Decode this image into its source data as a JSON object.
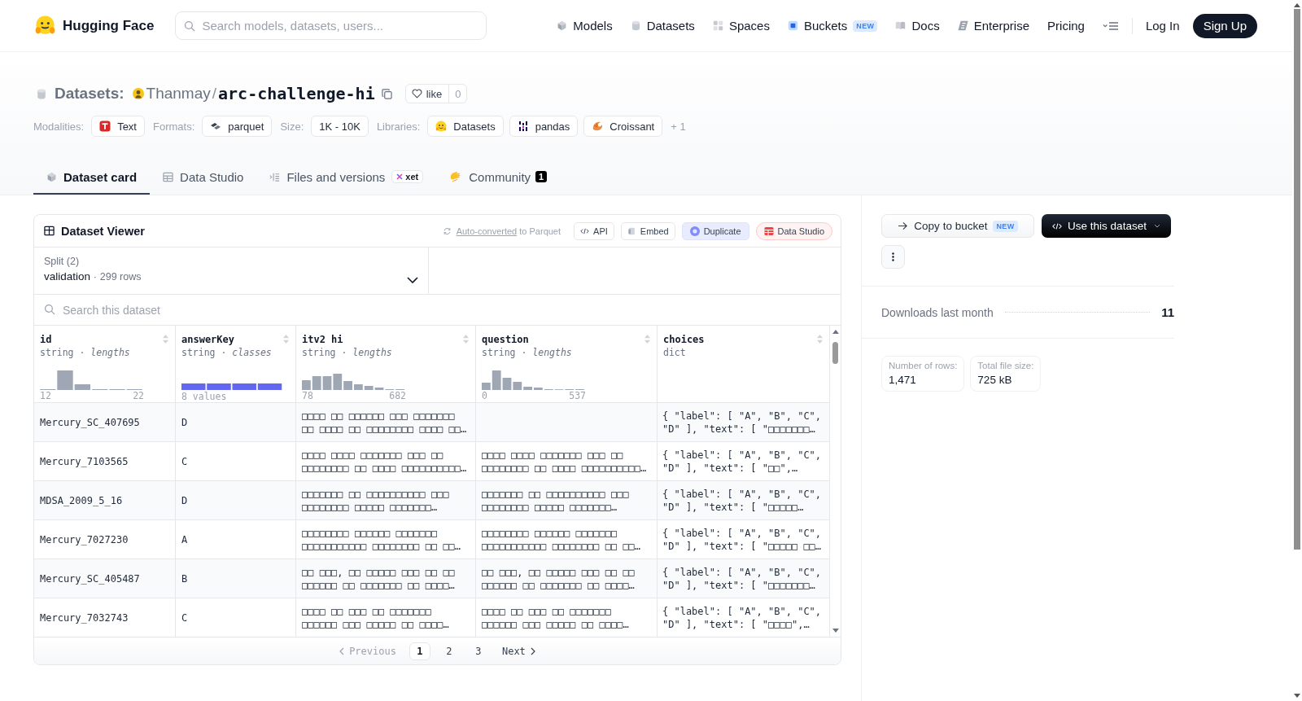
{
  "header": {
    "site_name": "Hugging Face",
    "search": {
      "placeholder": "Search models, datasets, users..."
    },
    "nav": [
      {
        "label": "Models",
        "kind": "models"
      },
      {
        "label": "Datasets",
        "kind": "datasets"
      },
      {
        "label": "Spaces",
        "kind": "spaces"
      },
      {
        "label": "Buckets",
        "kind": "buckets",
        "badge": "NEW"
      },
      {
        "label": "Docs",
        "kind": "docs"
      },
      {
        "label": "Enterprise",
        "kind": "enterprise"
      },
      {
        "label": "Pricing",
        "kind": "pricing"
      }
    ],
    "auth": [
      {
        "label": "Log In",
        "kind": "link"
      },
      {
        "label": "Sign Up",
        "kind": "primary"
      }
    ]
  },
  "dataset": {
    "section": "Datasets:",
    "owner": "Thanmay",
    "separator": "/",
    "name": "arc-challenge-hi",
    "like": {
      "label": "like",
      "count": "0"
    },
    "tag_groups": [
      {
        "label": "Modalities:",
        "chips": [
          {
            "text": "Text",
            "kind": "text"
          }
        ]
      },
      {
        "label": "Formats:",
        "chips": [
          {
            "text": "parquet",
            "kind": "parquet"
          }
        ]
      },
      {
        "label": "Size:",
        "chips": [
          {
            "text": "1K - 10K",
            "kind": "plain"
          }
        ]
      },
      {
        "label": "Libraries:",
        "chips": [
          {
            "text": "Datasets",
            "kind": "datasets"
          },
          {
            "text": "pandas",
            "kind": "pandas"
          },
          {
            "text": "Croissant",
            "kind": "croissant"
          }
        ]
      }
    ],
    "more_tags": "+ 1"
  },
  "tabs": [
    {
      "label": "Dataset card",
      "kind": "card",
      "selected": true
    },
    {
      "label": "Data Studio",
      "kind": "table",
      "selected": false
    },
    {
      "label": "Files and versions",
      "kind": "files",
      "badge": "xet",
      "selected": false
    },
    {
      "label": "Community",
      "kind": "community",
      "count": "1",
      "selected": false
    }
  ],
  "viewer": {
    "title": "Dataset Viewer",
    "conversion": {
      "link": "Auto-converted",
      "text": "to Parquet"
    },
    "actions": [
      {
        "label": "API",
        "kind": "api"
      },
      {
        "label": "Embed",
        "kind": "embed"
      },
      {
        "label": "Duplicate",
        "kind": "duplicate"
      },
      {
        "label": "Data Studio",
        "kind": "studio"
      }
    ],
    "split": {
      "label": "Split (2)",
      "value": "validation",
      "separator": "·",
      "rows": "299 rows"
    },
    "search": {
      "placeholder": "Search this dataset"
    },
    "columns": [
      {
        "name": "id",
        "type": "string · *lengths*",
        "kind": "histogram",
        "min": "12",
        "max": "22"
      },
      {
        "name": "answerKey",
        "type": "string · *classes*",
        "kind": "classes",
        "summary": "8 values"
      },
      {
        "name": "itv2 hi",
        "type": "string · *lengths*",
        "kind": "histogram",
        "min": "78",
        "max": "682"
      },
      {
        "name": "question",
        "type": "string · *lengths*",
        "kind": "histogram",
        "min": "0",
        "max": "537"
      },
      {
        "name": "choices",
        "type": "dict",
        "kind": "none"
      }
    ],
    "rows": [
      {
        "id": "Mercury_SC_407695",
        "answer_key": "D",
        "itv2_hi": "□□□□ □□ □□□□□□ □□□ □□□□□□□ □□ □□□□ □□ □□□□□□□□ □□□□ □□…",
        "choices": "{ \"label\": [ \"A\", \"B\", \"C\", \"D\" ], \"text\": [ \"□□□□□□□…"
      },
      {
        "id": "Mercury_7103565",
        "answer_key": "C",
        "itv2_hi": "□□□□ □□□□ □□□□□□□ □□□ □□ □□□□□□□□ □□ □□□□ □□□□□□□□□□…",
        "question": "□□□□ □□□□ □□□□□□□ □□□ □□ □□□□□□□□ □□ □□□□ □□□□□□□□□□…",
        "choices": "{ \"label\": [ \"A\", \"B\", \"C\", \"D\" ], \"text\": [ \"□□\",…"
      },
      {
        "id": "MDSA_2009_5_16",
        "answer_key": "D",
        "itv2_hi": "□□□□□□□ □□ □□□□□□□□□□ □□□ □□□□□□□□ □□□□□ □□□□□□□…",
        "question": "□□□□□□□ □□ □□□□□□□□□□ □□□ □□□□□□□□ □□□□□ □□□□□□□…",
        "choices": "{ \"label\": [ \"A\", \"B\", \"C\", \"D\" ], \"text\": [ \"□□□□□…"
      },
      {
        "id": "Mercury_7027230",
        "answer_key": "A",
        "itv2_hi": "□□□□□□□□ □□□□□□ □□□□□□□ □□□□□□□□□□□ □□□□□□□□ □□ □□…",
        "question": "□□□□□□□□ □□□□□□ □□□□□□□ □□□□□□□□□□□ □□□□□□□□ □□ □□…",
        "choices": "{ \"label\": [ \"A\", \"B\", \"C\", \"D\" ], \"text\": [ \"□□□□□ □□…"
      },
      {
        "id": "Mercury_SC_405487",
        "answer_key": "B",
        "itv2_hi": "□□ □□□, □□ □□□□□ □□□ □□ □□ □□□□□□ □□ □□□□□□□ □□ □□□□…",
        "question": "□□ □□□, □□ □□□□□ □□□ □□ □□ □□□□□□ □□ □□□□□□□ □□ □□□□…",
        "choices": "{ \"label\": [ \"A\", \"B\", \"C\", \"D\" ], \"text\": [ \"□□□□□□□…"
      },
      {
        "id": "Mercury_7032743",
        "answer_key": "C",
        "itv2_hi": "□□□□ □□ □□□ □□ □□□□□□□ □□□□□□ □□□ □□□□□ □□ □□□□…",
        "question": "□□□□ □□ □□□ □□ □□□□□□□ □□□□□□ □□□ □□□□□ □□ □□□□…",
        "choices": "{ \"label\": [ \"A\", \"B\", \"C\", \"D\" ], \"text\": [ \"□□□□\",…"
      }
    ],
    "pagination": {
      "previous": {
        "label": "Previous",
        "disabled": true
      },
      "pages": [
        {
          "label": "1",
          "selected": true
        },
        {
          "label": "2",
          "selected": false
        },
        {
          "label": "3",
          "selected": false
        }
      ],
      "next": {
        "label": "Next",
        "disabled": false
      }
    }
  },
  "sidebar": {
    "copy": {
      "label": "Copy to bucket",
      "badge": "NEW"
    },
    "use": {
      "label": "Use this dataset"
    },
    "downloads": {
      "label": "Downloads last month",
      "value": "11"
    },
    "stats": [
      {
        "label": "Number of rows:",
        "value": "1,471"
      },
      {
        "label": "Total file size:",
        "value": "725 kB"
      }
    ]
  }
}
